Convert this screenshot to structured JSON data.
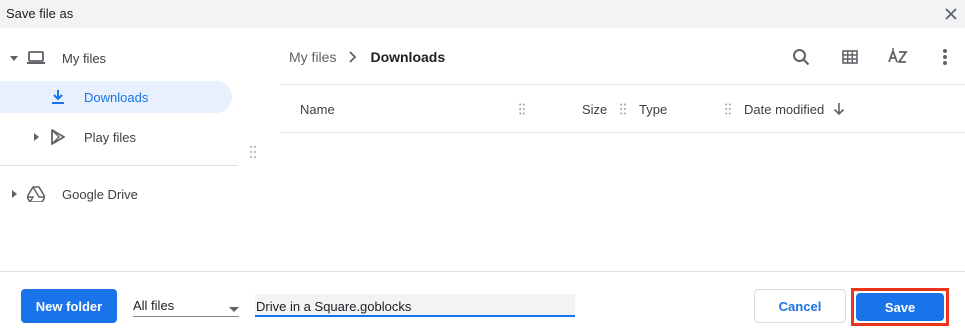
{
  "dialog": {
    "title": "Save file as"
  },
  "sidebar": {
    "items": [
      {
        "label": "My files"
      },
      {
        "label": "Downloads"
      },
      {
        "label": "Play files"
      },
      {
        "label": "Google Drive"
      }
    ]
  },
  "breadcrumb": {
    "root": "My files",
    "current": "Downloads"
  },
  "table": {
    "columns": [
      "Name",
      "Size",
      "Type",
      "Date modified"
    ],
    "sort_direction": "descending",
    "rows": []
  },
  "footer": {
    "new_folder_label": "New folder",
    "file_type_selected": "All files",
    "filename_value": "Drive in a Square.goblocks",
    "cancel_label": "Cancel",
    "save_label": "Save"
  },
  "icons": [
    "close-icon",
    "laptop-icon",
    "download-icon",
    "play-store-icon",
    "google-drive-icon",
    "search-icon",
    "grid-view-icon",
    "sort-az-icon",
    "more-vert-icon"
  ],
  "colors": {
    "accent": "#1a73e8",
    "selected_bg": "#e8f0fe",
    "highlight_border": "#e8341c"
  }
}
